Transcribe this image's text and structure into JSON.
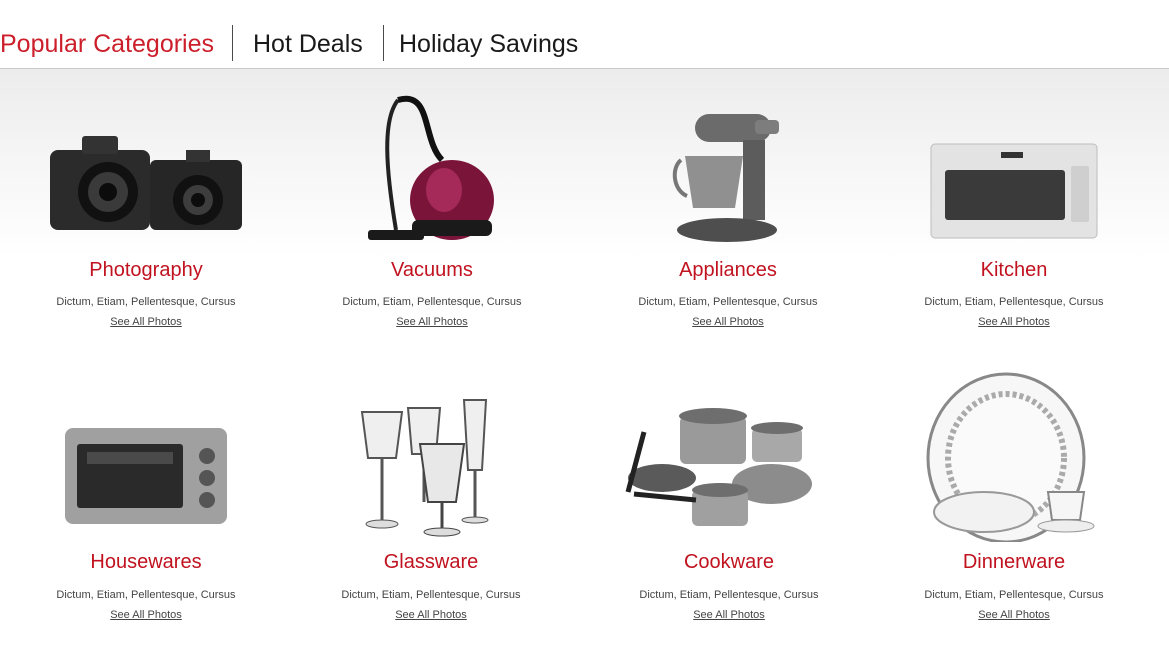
{
  "tabs": [
    {
      "label": "Popular Categories",
      "active": true
    },
    {
      "label": "Hot Deals",
      "active": false
    },
    {
      "label": "Holiday Savings",
      "active": false
    }
  ],
  "colors": {
    "accent": "#c1121f",
    "tab_active": "#cc1f2b",
    "text": "#444444"
  },
  "categories": [
    {
      "title": "Photography",
      "description": "Dictum, Etiam, Pellentesque, Cursus",
      "link": "See All Photos",
      "icon": "camera-icon"
    },
    {
      "title": "Vacuums",
      "description": "Dictum, Etiam, Pellentesque, Cursus",
      "link": "See All Photos",
      "icon": "vacuum-icon"
    },
    {
      "title": "Appliances",
      "description": "Dictum, Etiam, Pellentesque, Cursus",
      "link": "See All Photos",
      "icon": "stand-mixer-icon"
    },
    {
      "title": "Kitchen",
      "description": "Dictum, Etiam, Pellentesque, Cursus",
      "link": "See All Photos",
      "icon": "microwave-icon"
    },
    {
      "title": "Housewares",
      "description": "Dictum, Etiam, Pellentesque, Cursus",
      "link": "See All Photos",
      "icon": "toaster-oven-icon"
    },
    {
      "title": "Glassware",
      "description": "Dictum, Etiam, Pellentesque, Cursus",
      "link": "See All Photos",
      "icon": "wine-glasses-icon"
    },
    {
      "title": "Cookware",
      "description": "Dictum, Etiam, Pellentesque, Cursus",
      "link": "See All Photos",
      "icon": "cookware-set-icon"
    },
    {
      "title": "Dinnerware",
      "description": "Dictum, Etiam, Pellentesque, Cursus",
      "link": "See All Photos",
      "icon": "dinnerware-icon"
    }
  ]
}
